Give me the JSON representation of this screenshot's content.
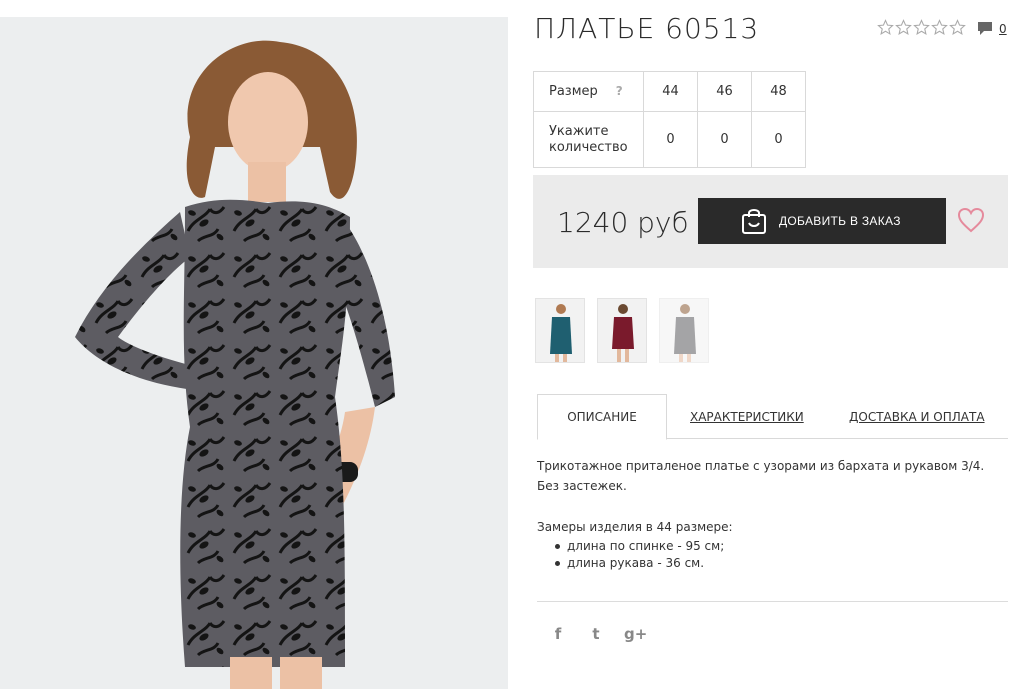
{
  "product": {
    "title": "ПЛАТЬЕ 60513",
    "rating_stars": 5,
    "rating_value": 0,
    "reviews_count": "0"
  },
  "sizes": {
    "label": "Размер",
    "help": "?",
    "values": [
      "44",
      "46",
      "48"
    ],
    "qty_label": "Укажите количество",
    "qty_values": [
      "0",
      "0",
      "0"
    ]
  },
  "price": {
    "amount": "1240 руб",
    "add_button": "ДОБАВИТЬ В ЗАКАЗ"
  },
  "thumbnails": [
    {
      "color": "#1f5f70"
    },
    {
      "color": "#7a1a2c"
    },
    {
      "color": "#5a5a5e"
    }
  ],
  "tabs": [
    {
      "label": "ОПИСАНИЕ",
      "active": true
    },
    {
      "label": "ХАРАКТЕРИСТИКИ",
      "active": false
    },
    {
      "label": "ДОСТАВКА И ОПЛАТА",
      "active": false
    }
  ],
  "description": {
    "text": "Трикотажное приталеное платье с узорами из бархата и рукавом 3/4. Без застежек.",
    "measures_title": "Замеры изделия в 44 размере:",
    "measures": [
      "длина по спинке - 95 см;",
      "длина рукава - 36 см."
    ]
  },
  "social": {
    "facebook": "f",
    "twitter": "t",
    "google": "g+"
  },
  "colors": {
    "button": "#2a2a2a",
    "heart": "#e58a9c",
    "panel": "#ebebeb"
  }
}
